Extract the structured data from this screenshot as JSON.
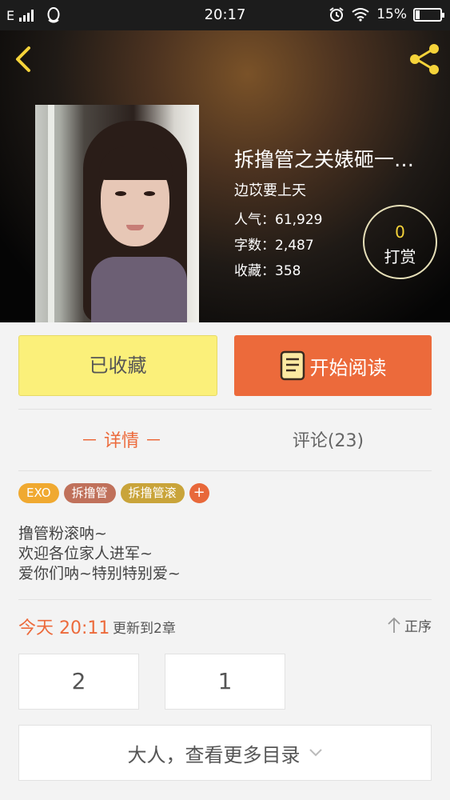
{
  "status_bar": {
    "network": "E",
    "time": "20:17",
    "battery": "15%",
    "battery_level": 0.15
  },
  "book": {
    "title": "拆撸管之关婊砸一…",
    "author": "边苡要上天",
    "popularity": "人气：61,929",
    "word_count": "字数：2,487",
    "favorites": "收藏：358",
    "reward_count": "0",
    "reward_label": "打赏"
  },
  "actions": {
    "collected_label": "已收藏",
    "read_label": "开始阅读"
  },
  "tabs": {
    "details": "－ 详情 －",
    "comments": "评论(23)"
  },
  "tags": [
    {
      "label": "EXO",
      "color": "#f0a930"
    },
    {
      "label": "拆撸管",
      "color": "#c0715b"
    },
    {
      "label": "拆撸管滚",
      "color": "#c9a43a"
    }
  ],
  "tag_add": "+",
  "description": [
    "撸管粉滚呐~",
    "欢迎各位家人进军~",
    "爱你们呐~特别特别爱~"
  ],
  "update": {
    "time": "今天 20:11",
    "text": "更新到2章",
    "sort_label": "正序"
  },
  "chapters": [
    "2",
    "1"
  ],
  "more_label": "大人，查看更多目录",
  "colors": {
    "accent": "#ec6a3b",
    "collected_bg": "#fbf07a",
    "reward_number": "#f5d33a"
  }
}
